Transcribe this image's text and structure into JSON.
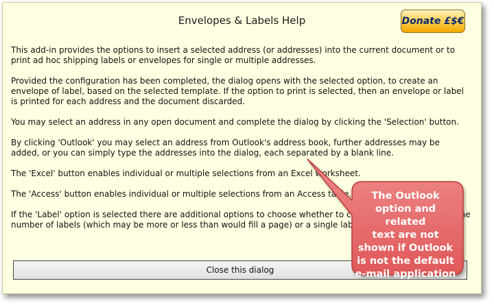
{
  "dialog": {
    "title": "Envelopes & Labels Help",
    "donate_label": "Donate £$€",
    "paragraphs": [
      "This add-in provides the options to insert a selected address (or addresses) into the current document or to print ad hoc shipping labels or envelopes for single or multiple addresses.",
      "Provided the configuration has been completed, the dialog opens with the selected option, to create an envelope of label, based on the selected template. If the option to print is selected, then an envelope or label is printed for each address and the document discarded.",
      "You may select an address in any open document and complete the dialog by clicking the 'Selection' button.",
      "By clicking 'Outlook' you may select an address from Outlook's address book, further addresses may be added, or you can simply type the addresses into the dialog, each separated by a blank line.",
      "The 'Excel' button enables individual or multiple selections from an Excel worksheet.",
      "The 'Access' button enables individual or multiple selections from an Access table.",
      "If the 'Label' option is selected there are additional options to choose whether to create a full page of the same number of labels (which may be more or less than would fill a page) or a single label."
    ],
    "close_label": "Close this dialog"
  },
  "callout": {
    "lines": [
      "The Outlook",
      "option and related",
      "text are not",
      "shown if Outlook",
      "is not the default",
      "e-mail application"
    ],
    "fill_color": "#e66a6a",
    "border_color": "#b83a3a"
  },
  "colors": {
    "window_background": "#ffffe1",
    "donate_gradient_top": "#fff2b8",
    "donate_gradient_bottom": "#f4a800",
    "donate_text": "#0b2a6e"
  }
}
